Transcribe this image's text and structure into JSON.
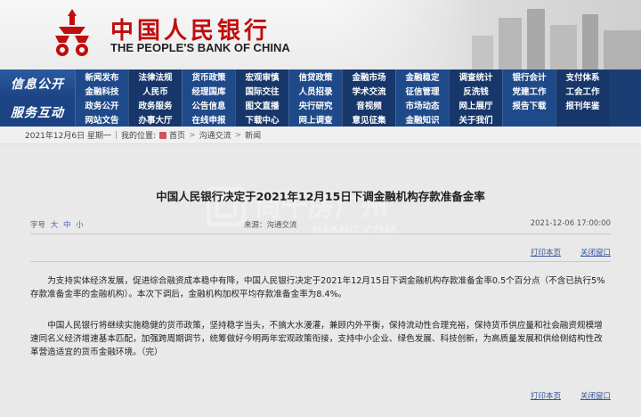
{
  "header": {
    "bank_cn": "中国人民银行",
    "bank_en": "THE PEOPLE'S BANK OF CHINA"
  },
  "nav": {
    "info_title": "信息公开",
    "service_title": "服务互动",
    "rows": [
      [
        "新闻发布",
        "法律法规",
        "货币政策",
        "宏观审慎",
        "信贷政策",
        "金融市场",
        "金融稳定",
        "调查统计",
        "银行会计",
        "支付体系"
      ],
      [
        "金融科技",
        "人民币",
        "经理国库",
        "国际交往",
        "人员招录",
        "学术交流",
        "征信管理",
        "反洗钱",
        "党建工作",
        "工会工作"
      ],
      [
        "政务公开",
        "政务服务",
        "公告信息",
        "图文直播",
        "央行研究",
        "音视频",
        "市场动态",
        "网上展厅",
        "报告下载",
        "报刊年鉴"
      ],
      [
        "网站文告",
        "办事大厅",
        "在线申报",
        "下载中心",
        "网上调查",
        "意见征集",
        "金融知识",
        "关于我们",
        "",
        ""
      ]
    ]
  },
  "breadcrumb": {
    "date": "2021年12月6日 星期一",
    "location_label": "我的位置:",
    "home": "首页",
    "level1": "沟通交流",
    "level2": "新闻"
  },
  "article": {
    "title": "中国人民银行决定于2021年12月15日下调金融机构存款准备金率",
    "font_label": "字号",
    "font_large": "大",
    "font_medium": "中",
    "font_small": "小",
    "source": "来源：沟通交流",
    "date": "2021-12-06 17:00:00",
    "print": "打印本页",
    "close": "关闭窗口",
    "paragraph1": "为支持实体经济发展，促进综合融资成本稳中有降，中国人民银行决定于2021年12月15日下调金融机构存款准备金率0.5个百分点（不含已执行5%存款准备金率的金融机构）。本次下调后，金融机构加权平均存款准备金率为8.4%。",
    "paragraph2": "中国人民银行将继续实施稳健的货币政策，坚持稳字当头，不搞大水漫灌，兼顾内外平衡，保持流动性合理充裕，保持货币供应量和社会融资规模增速同名义经济增速基本匹配，加强跨周期调节，统筹做好今明两年宏观政策衔接，支持中小企业、绿色发展、科技创新，为高质量发展和供给侧结构性改革营造适宜的货币金融环境。（完）"
  },
  "watermark": {
    "cn": "尚千房广州",
    "en": "NFANG.COM"
  },
  "colors": {
    "brand_red": "#c00d0d",
    "nav_blue": "#1a3d74",
    "link_blue": "#335599"
  }
}
